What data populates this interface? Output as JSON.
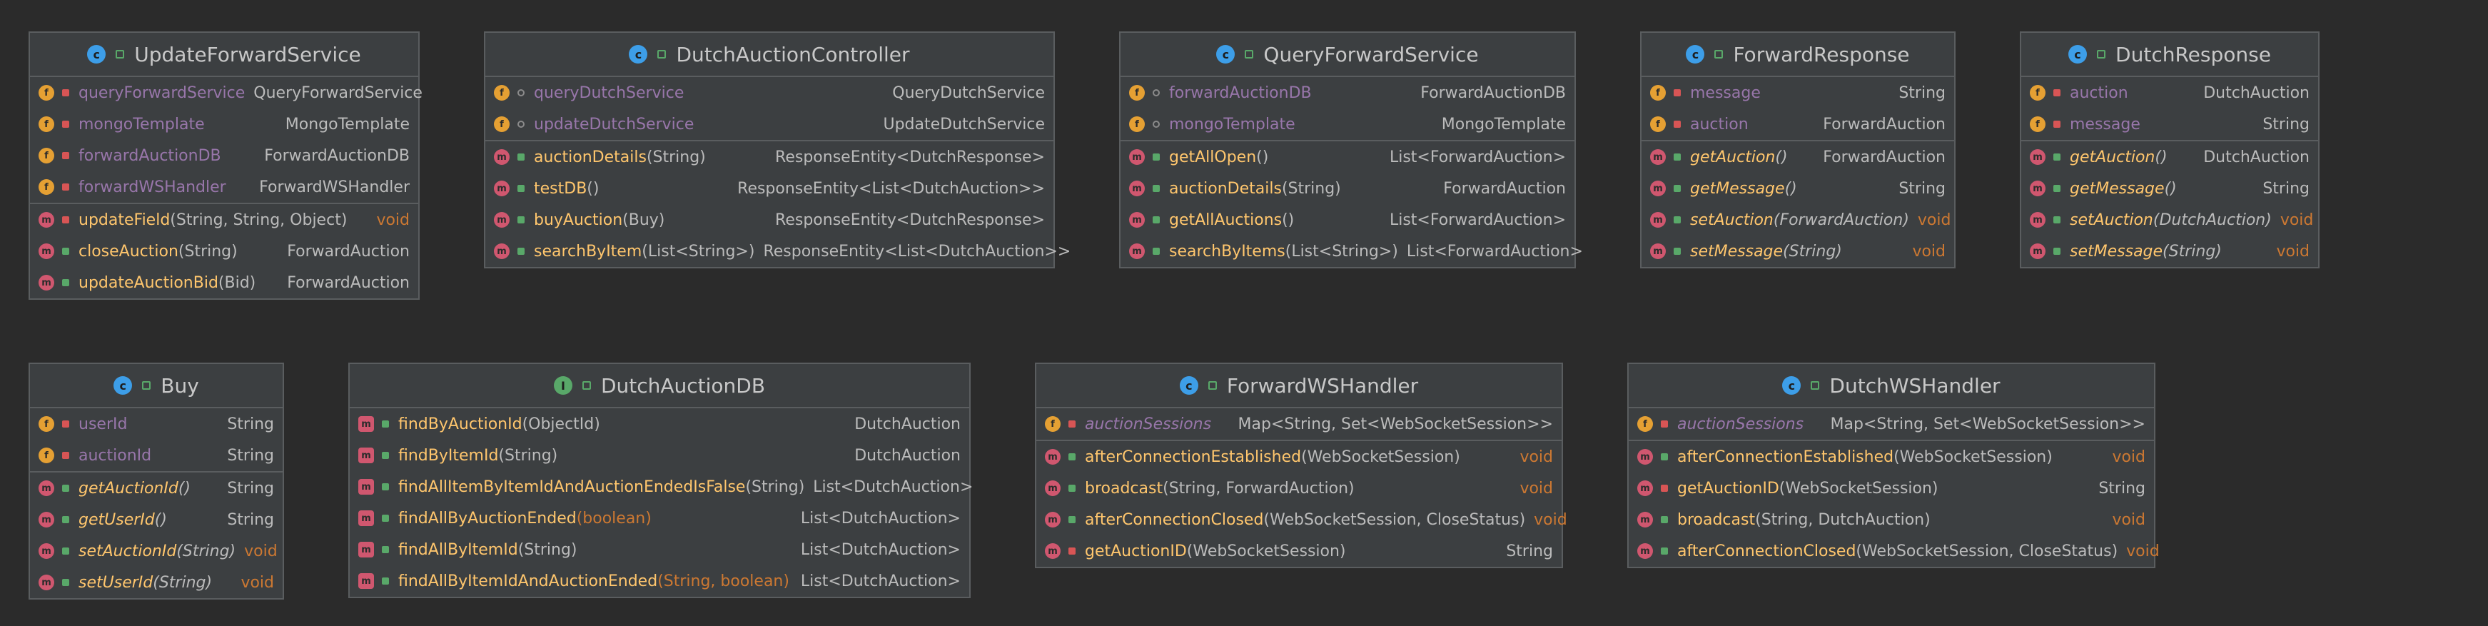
{
  "classes": [
    {
      "name": "UpdateForwardService",
      "kind": "class",
      "fields": [
        {
          "name": "queryForwardService",
          "type": "QueryForwardService",
          "vis": "private"
        },
        {
          "name": "mongoTemplate",
          "type": "MongoTemplate",
          "vis": "private"
        },
        {
          "name": "forwardAuctionDB",
          "type": "ForwardAuctionDB",
          "vis": "private"
        },
        {
          "name": "forwardWSHandler",
          "type": "ForwardWSHandler",
          "vis": "private"
        }
      ],
      "methods": [
        {
          "name": "updateField",
          "args": "(String, String, Object)",
          "type": "void",
          "vis": "private"
        },
        {
          "name": "closeAuction",
          "args": "(String)",
          "type": "ForwardAuction",
          "vis": "public"
        },
        {
          "name": "updateAuctionBid",
          "args": "(Bid)",
          "type": "ForwardAuction",
          "vis": "public"
        }
      ]
    },
    {
      "name": "DutchAuctionController",
      "kind": "class",
      "fields": [
        {
          "name": "queryDutchService",
          "type": "QueryDutchService",
          "vis": "package"
        },
        {
          "name": "updateDutchService",
          "type": "UpdateDutchService",
          "vis": "package"
        }
      ],
      "methods": [
        {
          "name": "auctionDetails",
          "args": "(String)",
          "type": "ResponseEntity<DutchResponse>",
          "vis": "public"
        },
        {
          "name": "testDB",
          "args": "()",
          "type": "ResponseEntity<List<DutchAuction>>",
          "vis": "public"
        },
        {
          "name": "buyAuction",
          "args": "(Buy)",
          "type": "ResponseEntity<DutchResponse>",
          "vis": "public"
        },
        {
          "name": "searchByItem",
          "args": "(List<String>)",
          "type": "ResponseEntity<List<DutchAuction>>",
          "vis": "public"
        }
      ]
    },
    {
      "name": "QueryForwardService",
      "kind": "class",
      "fields": [
        {
          "name": "forwardAuctionDB",
          "type": "ForwardAuctionDB",
          "vis": "package"
        },
        {
          "name": "mongoTemplate",
          "type": "MongoTemplate",
          "vis": "package"
        }
      ],
      "methods": [
        {
          "name": "getAllOpen",
          "args": "()",
          "type": "List<ForwardAuction>",
          "vis": "public"
        },
        {
          "name": "auctionDetails",
          "args": "(String)",
          "type": "ForwardAuction",
          "vis": "public"
        },
        {
          "name": "getAllAuctions",
          "args": "()",
          "type": "List<ForwardAuction>",
          "vis": "public"
        },
        {
          "name": "searchByItems",
          "args": "(List<String>)",
          "type": "List<ForwardAuction>",
          "vis": "public"
        }
      ]
    },
    {
      "name": "ForwardResponse",
      "kind": "class",
      "fields": [
        {
          "name": "message",
          "type": "String",
          "vis": "private"
        },
        {
          "name": "auction",
          "type": "ForwardAuction",
          "vis": "private"
        }
      ],
      "methods": [
        {
          "name": "getAuction",
          "args": "()",
          "type": "ForwardAuction",
          "vis": "public",
          "italic": true
        },
        {
          "name": "getMessage",
          "args": "()",
          "type": "String",
          "vis": "public",
          "italic": true
        },
        {
          "name": "setAuction",
          "args": "(ForwardAuction)",
          "type": "void",
          "vis": "public",
          "italic": true
        },
        {
          "name": "setMessage",
          "args": "(String)",
          "type": "void",
          "vis": "public",
          "italic": true
        }
      ]
    },
    {
      "name": "DutchResponse",
      "kind": "class",
      "fields": [
        {
          "name": "auction",
          "type": "DutchAuction",
          "vis": "private"
        },
        {
          "name": "message",
          "type": "String",
          "vis": "private"
        }
      ],
      "methods": [
        {
          "name": "getAuction",
          "args": "()",
          "type": "DutchAuction",
          "vis": "public",
          "italic": true
        },
        {
          "name": "getMessage",
          "args": "()",
          "type": "String",
          "vis": "public",
          "italic": true
        },
        {
          "name": "setAuction",
          "args": "(DutchAuction)",
          "type": "void",
          "vis": "public",
          "italic": true
        },
        {
          "name": "setMessage",
          "args": "(String)",
          "type": "void",
          "vis": "public",
          "italic": true
        }
      ]
    },
    {
      "name": "Buy",
      "kind": "class",
      "fields": [
        {
          "name": "userId",
          "type": "String",
          "vis": "private"
        },
        {
          "name": "auctionId",
          "type": "String",
          "vis": "private"
        }
      ],
      "methods": [
        {
          "name": "getAuctionId",
          "args": "()",
          "type": "String",
          "vis": "public",
          "italic": true
        },
        {
          "name": "getUserId",
          "args": "()",
          "type": "String",
          "vis": "public",
          "italic": true
        },
        {
          "name": "setAuctionId",
          "args": "(String)",
          "type": "void",
          "vis": "public",
          "italic": true
        },
        {
          "name": "setUserId",
          "args": "(String)",
          "type": "void",
          "vis": "public",
          "italic": true
        }
      ]
    },
    {
      "name": "DutchAuctionDB",
      "kind": "interface",
      "fields": [],
      "methods": [
        {
          "name": "findByAuctionId",
          "args": "(ObjectId)",
          "type": "DutchAuction",
          "vis": "public",
          "abstract": true
        },
        {
          "name": "findByItemId",
          "args": "(String)",
          "type": "DutchAuction",
          "vis": "public",
          "abstract": true
        },
        {
          "name": "findAllItemByItemIdAndAuctionEndedIsFalse",
          "args": "(String)",
          "type": "List<DutchAuction>",
          "vis": "public",
          "abstract": true
        },
        {
          "name": "findAllByAuctionEnded",
          "args": "(boolean)",
          "argsKw": true,
          "type": "List<DutchAuction>",
          "vis": "public",
          "abstract": true
        },
        {
          "name": "findAllByItemId",
          "args": "(String)",
          "type": "List<DutchAuction>",
          "vis": "public",
          "abstract": true
        },
        {
          "name": "findAllByItemIdAndAuctionEnded",
          "args": "(String, boolean)",
          "argsKw": true,
          "type": "List<DutchAuction>",
          "vis": "public",
          "abstract": true
        }
      ]
    },
    {
      "name": "ForwardWSHandler",
      "kind": "class",
      "fields": [
        {
          "name": "auctionSessions",
          "type": "Map<String, Set<WebSocketSession>>",
          "vis": "private",
          "italic": true,
          "static": true
        }
      ],
      "methods": [
        {
          "name": "afterConnectionEstablished",
          "args": "(WebSocketSession)",
          "type": "void",
          "vis": "public"
        },
        {
          "name": "broadcast",
          "args": "(String, ForwardAuction)",
          "type": "void",
          "vis": "public"
        },
        {
          "name": "afterConnectionClosed",
          "args": "(WebSocketSession, CloseStatus)",
          "type": "void",
          "vis": "public"
        },
        {
          "name": "getAuctionID",
          "args": "(WebSocketSession)",
          "type": "String",
          "vis": "private"
        }
      ]
    },
    {
      "name": "DutchWSHandler",
      "kind": "class",
      "fields": [
        {
          "name": "auctionSessions",
          "type": "Map<String, Set<WebSocketSession>>",
          "vis": "private",
          "italic": true,
          "static": true
        }
      ],
      "methods": [
        {
          "name": "afterConnectionEstablished",
          "args": "(WebSocketSession)",
          "type": "void",
          "vis": "public"
        },
        {
          "name": "getAuctionID",
          "args": "(WebSocketSession)",
          "type": "String",
          "vis": "private"
        },
        {
          "name": "broadcast",
          "args": "(String, DutchAuction)",
          "type": "void",
          "vis": "public"
        },
        {
          "name": "afterConnectionClosed",
          "args": "(WebSocketSession, CloseStatus)",
          "type": "void",
          "vis": "public"
        }
      ]
    }
  ]
}
